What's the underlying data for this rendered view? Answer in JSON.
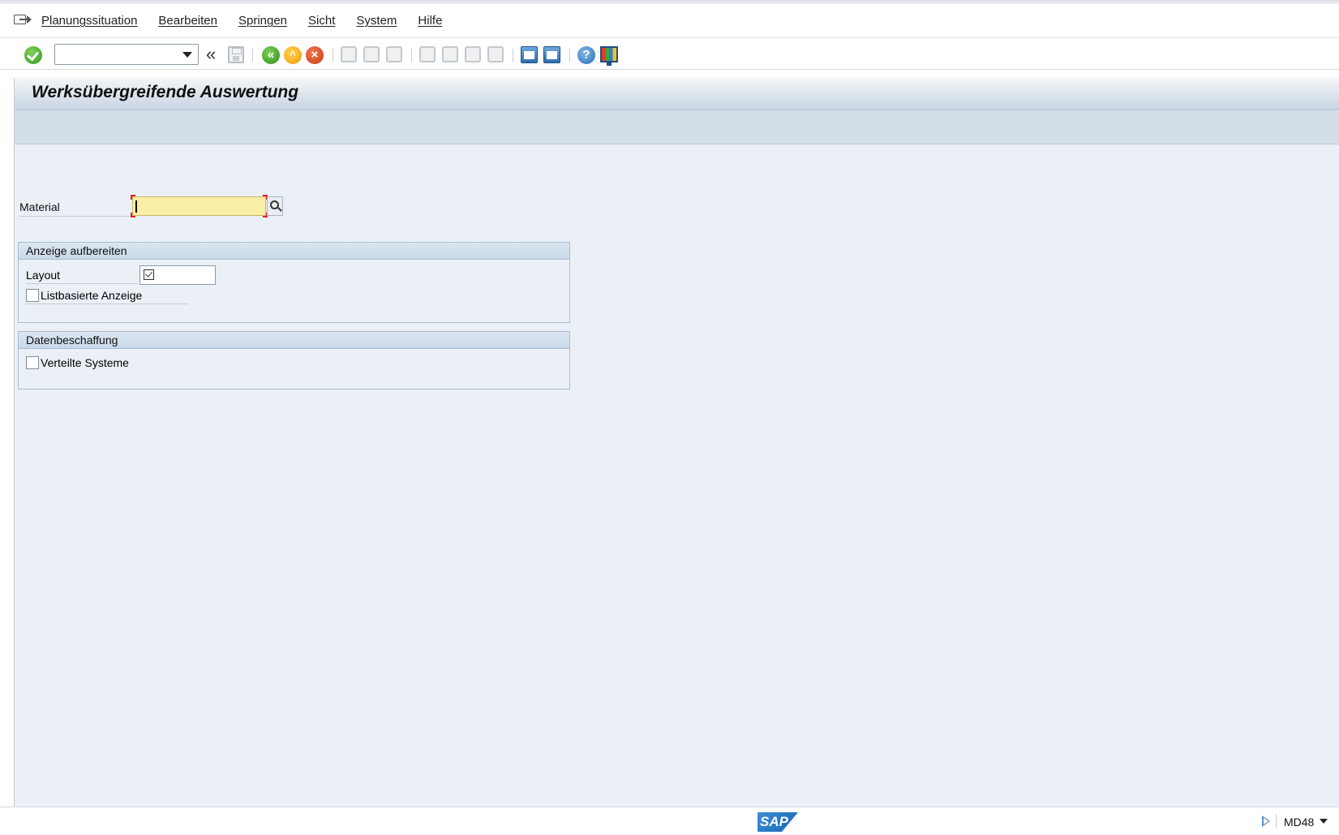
{
  "menubar": {
    "items": [
      "Planungssituation",
      "Bearbeiten",
      "Springen",
      "Sicht",
      "System",
      "Hilfe"
    ]
  },
  "toolbar": {
    "command_field_value": "",
    "back_symbol": "«",
    "help_symbol": "?"
  },
  "screen": {
    "title": "Werksübergreifende Auswertung"
  },
  "form": {
    "material_label": "Material",
    "material_value": ""
  },
  "groups": {
    "display": {
      "title": "Anzeige aufbereiten",
      "layout_label": "Layout",
      "list_display_label": "Listbasierte Anzeige",
      "list_display_checked": false
    },
    "data_procurement": {
      "title": "Datenbeschaffung",
      "distributed_systems_label": "Verteilte Systeme",
      "distributed_systems_checked": false
    }
  },
  "statusbar": {
    "logo_text": "SAP",
    "transaction_code": "MD48"
  },
  "colors": {
    "required_field": "#fbeea5",
    "main_background": "#eaf0f6",
    "title_bar": "#c8d5e2"
  }
}
